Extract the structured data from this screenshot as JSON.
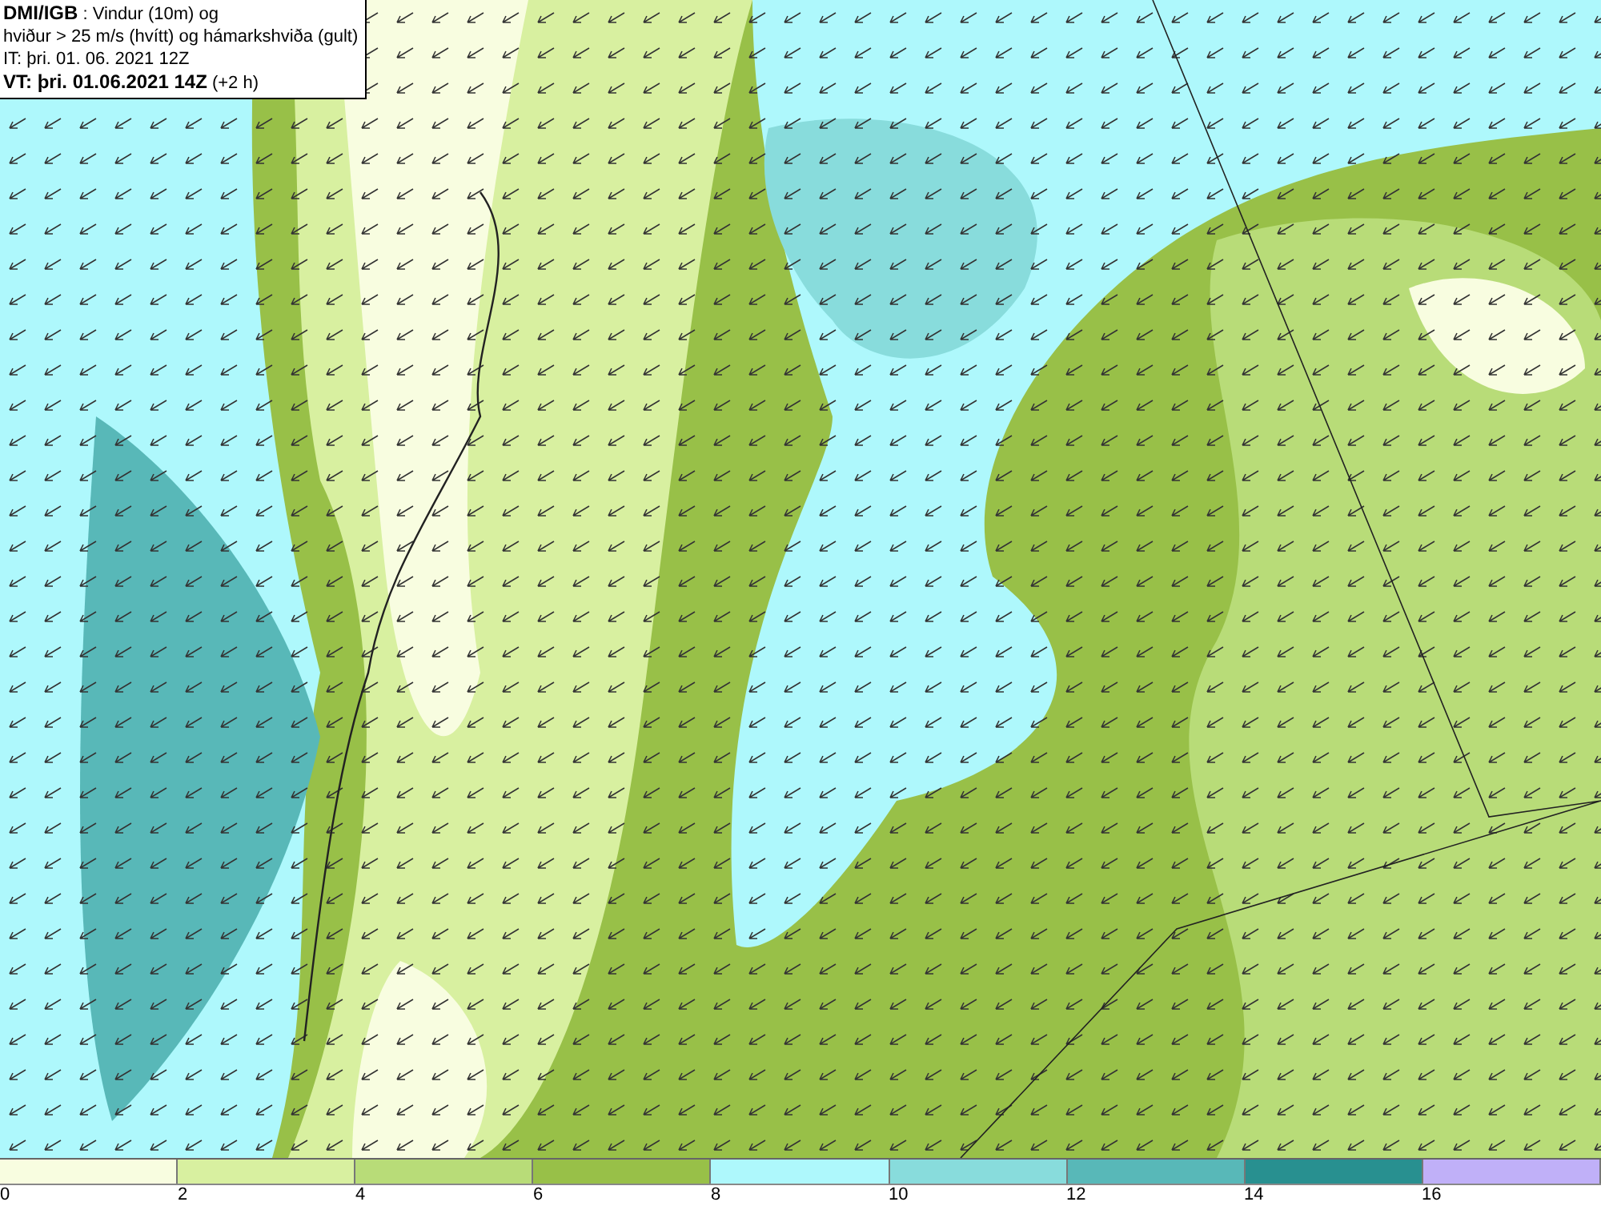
{
  "title_box": {
    "lines": [
      "**DMI/IGB** : Vindur (10m) og",
      "hviður > 25 m/s (hvítt) og hámarkshviða (gult)",
      "IT: þri. 01. 06. 2021 12Z",
      "**VT: þri. 01.06.2021 14Z** (+2 h)"
    ]
  },
  "legend": {
    "bins": [
      {
        "color": "#f8fde0"
      },
      {
        "color": "#d8f0a0"
      },
      {
        "color": "#b8dc78"
      },
      {
        "color": "#98c048"
      },
      {
        "color": "#aef8fc"
      },
      {
        "color": "#88dcdc"
      },
      {
        "color": "#58b8b8"
      },
      {
        "color": "#289090"
      },
      {
        "color": "#c0b0f8"
      }
    ],
    "ticks": [
      "0",
      "2",
      "4",
      "6",
      "8",
      "10",
      "12",
      "14",
      "16"
    ]
  }
}
